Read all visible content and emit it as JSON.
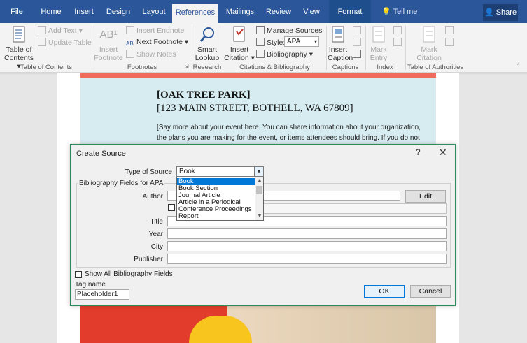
{
  "tabs": [
    {
      "label": "File"
    },
    {
      "label": "Home"
    },
    {
      "label": "Insert"
    },
    {
      "label": "Design"
    },
    {
      "label": "Layout"
    },
    {
      "label": "References"
    },
    {
      "label": "Mailings"
    },
    {
      "label": "Review"
    },
    {
      "label": "View"
    },
    {
      "label": "Format"
    }
  ],
  "tellme": "Tell me",
  "share": "Share",
  "ribbon": {
    "toc": {
      "btn_line1": "Table of",
      "btn_line2": "Contents",
      "add_text": "Add Text",
      "update_table": "Update Table",
      "group": "Table of Contents"
    },
    "footnotes": {
      "insert_footnote_1": "Insert",
      "insert_footnote_2": "Footnote",
      "insert_endnote": "Insert Endnote",
      "next_footnote": "Next Footnote",
      "show_notes": "Show Notes",
      "group": "Footnotes"
    },
    "research": {
      "smart_lookup_1": "Smart",
      "smart_lookup_2": "Lookup",
      "group": "Research"
    },
    "citations": {
      "insert_citation_1": "Insert",
      "insert_citation_2": "Citation",
      "manage_sources": "Manage Sources",
      "style_label": "Style:",
      "style_value": "APA",
      "bibliography": "Bibliography",
      "group": "Citations & Bibliography"
    },
    "captions": {
      "insert_caption_1": "Insert",
      "insert_caption_2": "Caption",
      "group": "Captions"
    },
    "index": {
      "mark_entry_1": "Mark",
      "mark_entry_2": "Entry",
      "group": "Index"
    },
    "authorities": {
      "mark_citation_1": "Mark",
      "mark_citation_2": "Citation",
      "group": "Table of Authorities"
    }
  },
  "document": {
    "title": "[OAK TREE PARK]",
    "address": "[123 MAIN STREET, BOTHELL, WA 67809]",
    "body": "[Say more about your event here. You can share information about your organization, the plans you are making for the event, or items attendees should bring. If you do not"
  },
  "dialog": {
    "title": "Create Source",
    "help": "?",
    "close": "✕",
    "type_label": "Type of Source",
    "type_value": "Book",
    "dropdown": [
      "Book",
      "Book Section",
      "Journal Article",
      "Article in a Periodical",
      "Conference Proceedings",
      "Report"
    ],
    "group_caption": "Bibliography Fields for APA",
    "fields": [
      {
        "label": "Author",
        "value": ""
      },
      {
        "label": "Title",
        "value": ""
      },
      {
        "label": "Year",
        "value": ""
      },
      {
        "label": "City",
        "value": ""
      },
      {
        "label": "Publisher",
        "value": ""
      }
    ],
    "edit_button": "Edit",
    "show_all": "Show All Bibliography Fields",
    "tag_label": "Tag name",
    "tag_value": "Placeholder1",
    "ok": "OK",
    "cancel": "Cancel"
  }
}
